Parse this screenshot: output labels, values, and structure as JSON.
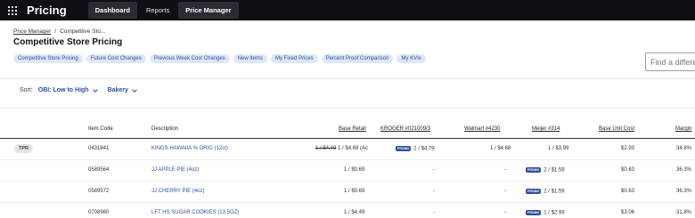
{
  "app": {
    "title": "Pricing"
  },
  "nav": [
    "Dashboard",
    "Reports",
    "Price Manager"
  ],
  "breadcrumb": {
    "parent": "Price Manager",
    "separator": "/",
    "current": "Competitive Sto..."
  },
  "page_title": "Competitive Store Pricing",
  "pills": [
    "Competitive Store Pricing",
    "Future Cost Changes",
    "Previous Week Cost Changes",
    "New Items",
    "My Fixed Prices",
    "Percent Proof Comparison",
    "My KVIs"
  ],
  "search": {
    "placeholder": "Find a differe"
  },
  "sort": {
    "label": "Sort:",
    "value": "OBI: Low to High",
    "category": "Bakery"
  },
  "table": {
    "headers": {
      "item_code": "Item Code",
      "description": "Description",
      "base_retail": "Base Retail",
      "kroger": "KROGER #021009/3",
      "walmart": "Walmart #4230",
      "meijer": "Meijer #314",
      "base_unit_cost": "Base Unit Cost",
      "margin": "Margin"
    },
    "badge_text": "PROMO",
    "rows": [
      {
        "tag": "TPR",
        "item_code": "0431841",
        "description": "KINGS HAWAIIA % ORIG (12ct)",
        "base_retail_old": "1 / $4.49",
        "base_retail": " 1 / $4.69 (Ac",
        "kroger": "1 / $4.79",
        "kroger_promo": true,
        "walmart": "1 / $4.68",
        "meijer": "1 / $3.99",
        "meijer_promo": false,
        "cost": "$2.93",
        "margin": "34.8%"
      },
      {
        "tag": "",
        "item_code": "0589564",
        "description": "JJ APPLE PIE (4oz)",
        "base_retail_old": "",
        "base_retail": "1 / $0.69",
        "kroger": "-",
        "kroger_promo": false,
        "walmart": "-",
        "meijer": "2 / $1.59",
        "meijer_promo": true,
        "cost": "$0.63",
        "margin": "36.3%"
      },
      {
        "tag": "",
        "item_code": "0589572",
        "description": "JJ CHERRY PIE (4oz)",
        "base_retail_old": "",
        "base_retail": "1 / $0.69",
        "kroger": "-",
        "kroger_promo": false,
        "walmart": "-",
        "meijer": "2 / $1.59",
        "meijer_promo": true,
        "cost": "$0.63",
        "margin": "36.3%"
      },
      {
        "tag": "",
        "item_code": "0708980",
        "description": "LFT HS SUGAR COOKIES (13.5OZ)",
        "base_retail_old": "",
        "base_retail": "1 / $4.49",
        "kroger": "-",
        "kroger_promo": false,
        "walmart": "-",
        "meijer": "1 / $2.99",
        "meijer_promo": true,
        "cost": "$3.06",
        "margin": "31.8%"
      }
    ]
  }
}
